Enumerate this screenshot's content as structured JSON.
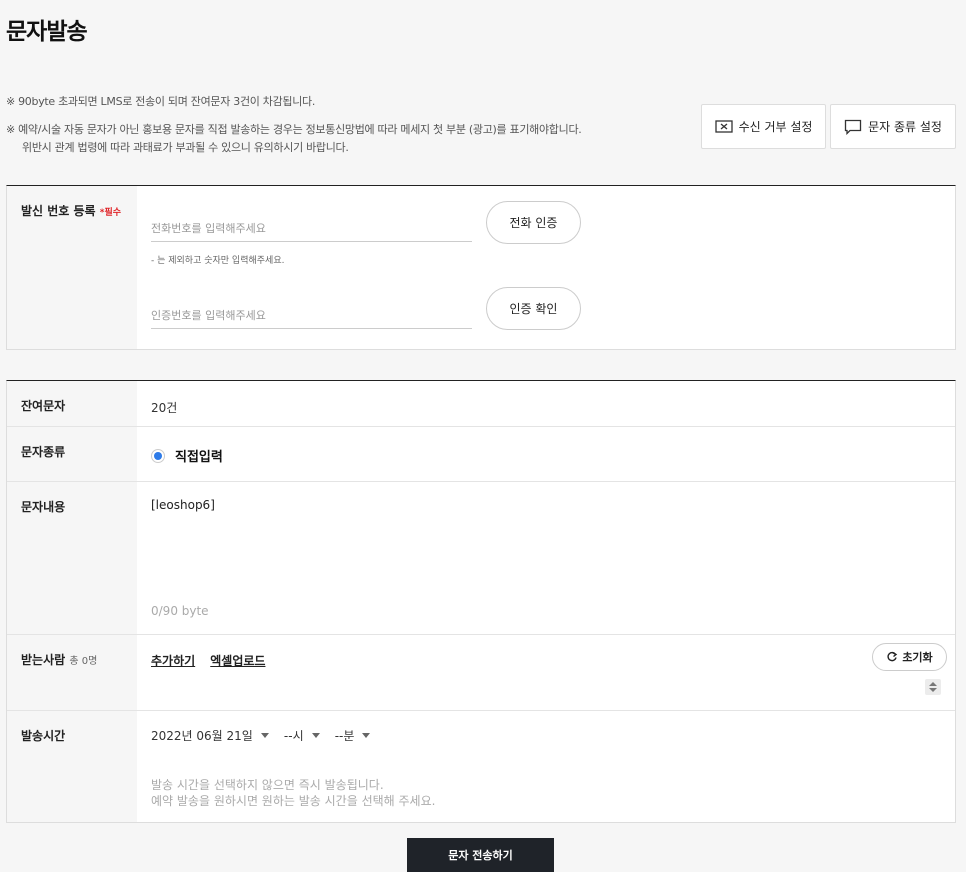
{
  "page": {
    "title": "문자발송"
  },
  "notices": {
    "n1": "※ 90byte 초과되면 LMS로 전송이 되며 잔여문자 3건이 차감됩니다.",
    "n2_line1": "※ 예약/시술 자동 문자가 아닌 홍보용 문자를 직접 발송하는 경우는 정보통신망법에 따라 메세지 첫 부분 (광고)를 표기해야합니다.",
    "n2_line2": "위반시 관계 법령에 따라 과태료가 부과될 수 있으니 유의하시기 바랍니다."
  },
  "top_buttons": {
    "reject": "수신 거부 설정",
    "type": "문자 종류 설정"
  },
  "registration": {
    "label": "발신 번호 등록",
    "required": "*필수",
    "phone_placeholder": "전화번호를 입력해주세요",
    "phone_verify_button": "전화 인증",
    "hint": "- 는 제외하고 숫자만 입력해주세요.",
    "code_placeholder": "인증번호를 입력해주세요",
    "code_confirm_button": "인증 확인"
  },
  "form": {
    "remaining": {
      "label": "잔여문자",
      "value": "20건"
    },
    "msg_type": {
      "label": "문자종류",
      "option": "직접입력"
    },
    "content": {
      "label": "문자내용",
      "text": "[leoshop6]",
      "bytes": "0/90 byte"
    },
    "recipients": {
      "label": "받는사람",
      "count": "총 0명",
      "add_link": "추가하기",
      "excel_link": "엑셀업로드",
      "reset_button": "초기화"
    },
    "send_time": {
      "label": "발송시간",
      "date": "2022년 06월 21일",
      "hour": "--시",
      "minute": "--분",
      "help_line1": "발송 시간을 선택하지 않으면 즉시 발송됩니다.",
      "help_line2": "예약 발송을 원하시면 원하는 발송 시간을 선택해 주세요."
    }
  },
  "submit": {
    "label": "문자 전송하기"
  },
  "colors": {
    "accent": "#2e7be8",
    "required": "#e0262a",
    "submit_bg": "#1f2329"
  }
}
